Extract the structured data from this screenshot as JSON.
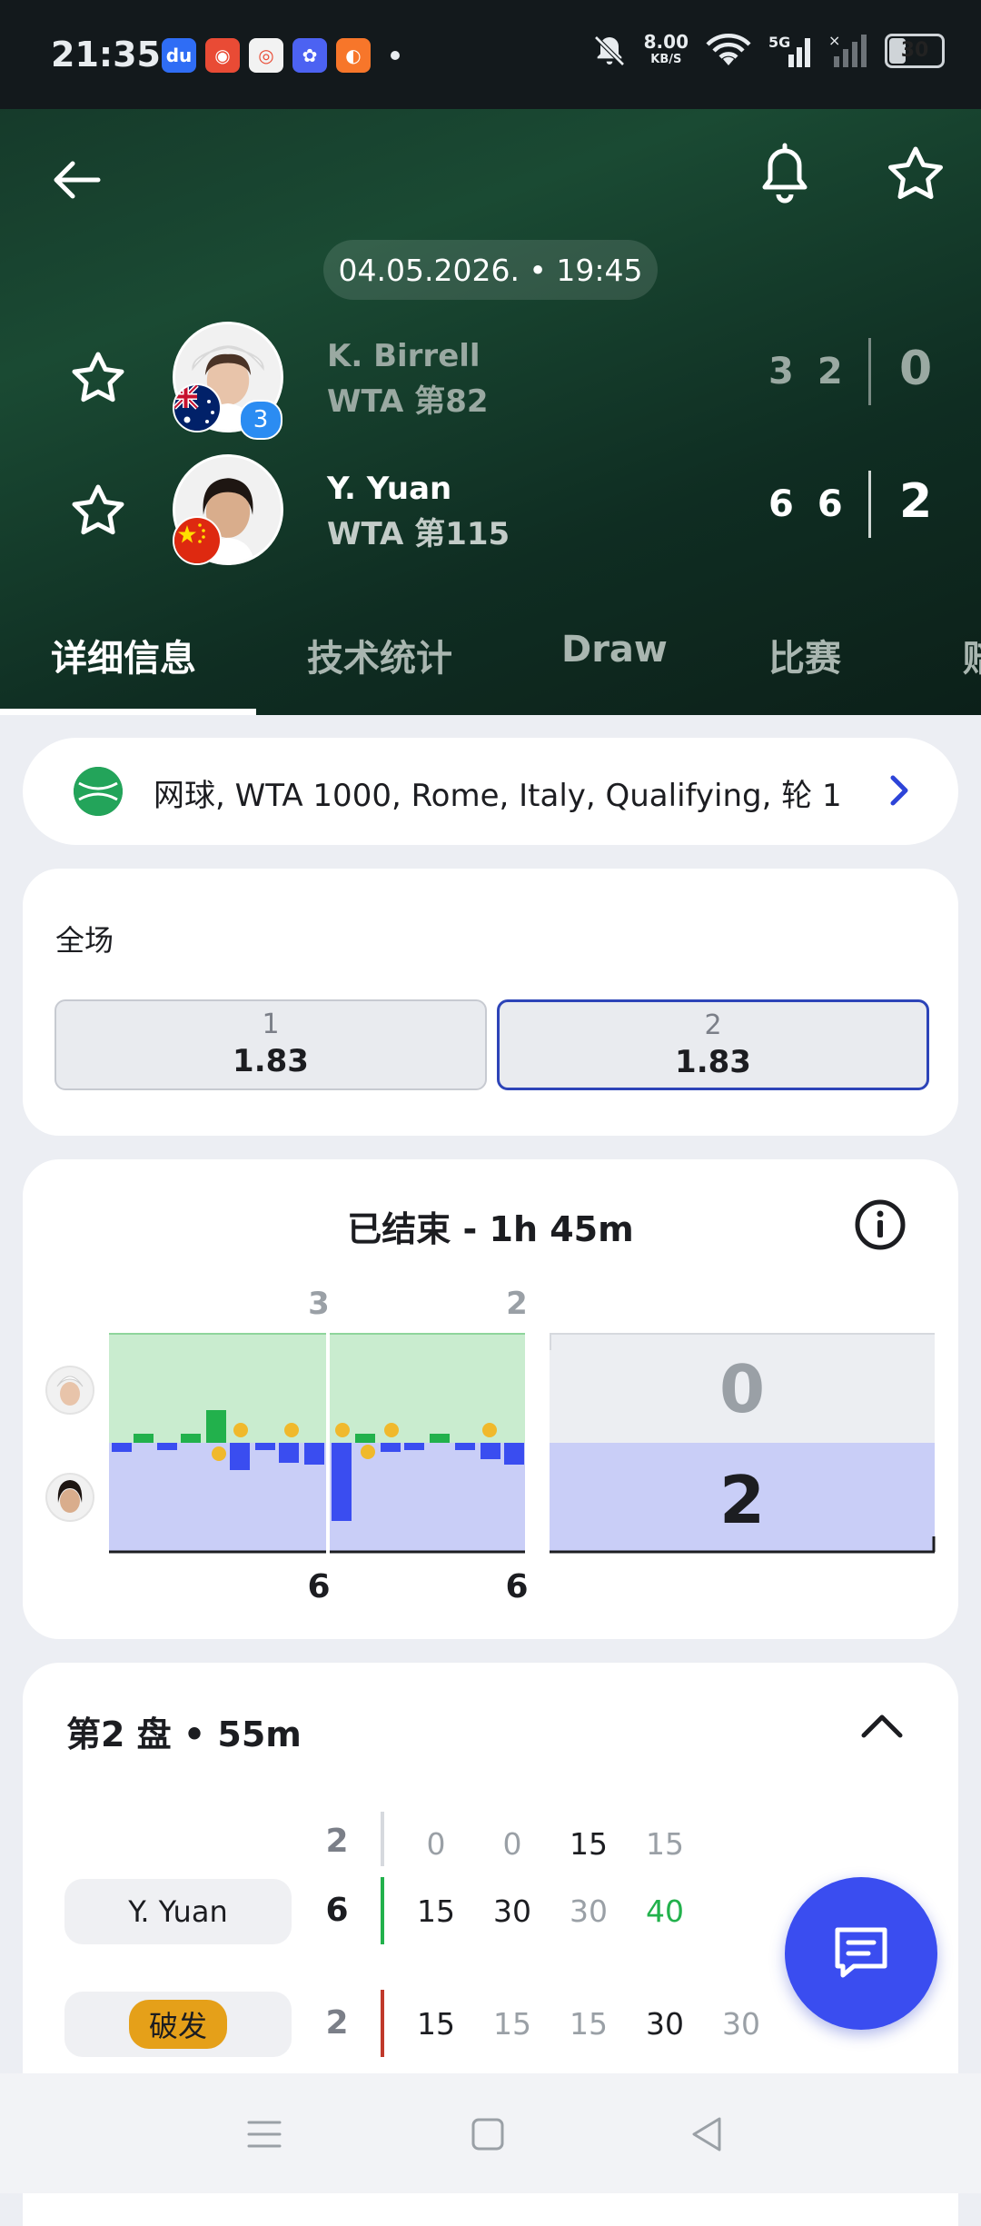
{
  "status_bar": {
    "time": "21:35",
    "net_speed": "8.00",
    "net_unit": "KB/S",
    "battery": "30",
    "signal": "5G"
  },
  "header": {
    "date": "04.05.2026. • 19:45",
    "players": [
      {
        "name": "K. Birrell",
        "rank": "WTA 第82",
        "seed": "3",
        "sets": [
          "3",
          "2"
        ],
        "total": "0"
      },
      {
        "name": "Y. Yuan",
        "rank": "WTA 第115",
        "sets": [
          "6",
          "6"
        ],
        "total": "2"
      }
    ]
  },
  "tabs": [
    "详细信息",
    "技术统计",
    "Draw",
    "比赛",
    "赔"
  ],
  "league": {
    "text": "网球, WTA 1000, Rome, Italy, Qualifying, 轮 1"
  },
  "odds": {
    "title": "全场",
    "options": [
      {
        "label": "1",
        "value": "1.83"
      },
      {
        "label": "2",
        "value": "1.83"
      }
    ]
  },
  "momentum": {
    "title": "已结束 - 1h 45m",
    "set_scores_top": [
      "3",
      "2"
    ],
    "set_scores_bottom": [
      "6",
      "6"
    ],
    "total_top": "0",
    "total_bottom": "2"
  },
  "set_detail": {
    "title": "第2 盘 • 55m",
    "header_game": "2",
    "header_points": [
      "0",
      "0",
      "15",
      "15"
    ],
    "rows": [
      {
        "label": "Y. Yuan",
        "game": "6",
        "points": [
          "15",
          "30",
          "30",
          "40"
        ]
      },
      {
        "label": "破发",
        "game": "2",
        "points": [
          "15",
          "15",
          "15",
          "30",
          "30"
        ]
      }
    ]
  },
  "colors": {
    "accent": "#3a4df0",
    "header_green": "#1a4a33",
    "win_green": "#22b14c",
    "loss_blue": "#3a4df0",
    "break_badge": "#e5a019"
  }
}
